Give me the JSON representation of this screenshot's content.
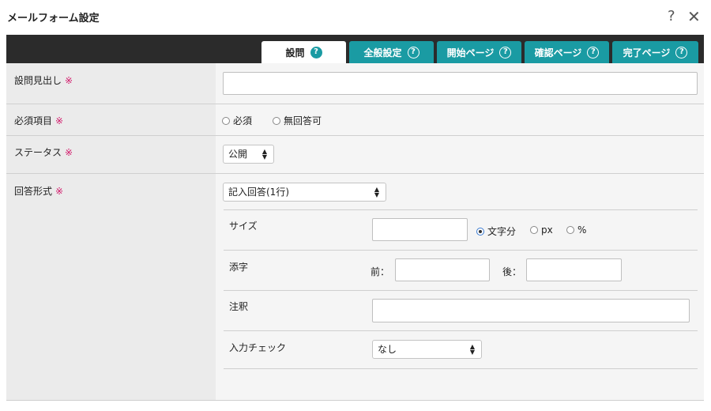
{
  "dialog": {
    "title": "メールフォーム設定",
    "help_icon": "?",
    "close_icon": "✕"
  },
  "tabs": [
    {
      "label": "設問",
      "active": true
    },
    {
      "label": "全般設定",
      "active": false
    },
    {
      "label": "開始ページ",
      "active": false
    },
    {
      "label": "確認ページ",
      "active": false
    },
    {
      "label": "完了ページ",
      "active": false
    }
  ],
  "tab_help": "?",
  "required_mark": "※",
  "fields": {
    "heading": {
      "label": "設問見出し",
      "value": ""
    },
    "required": {
      "label": "必須項目",
      "options": [
        "必須",
        "無回答可"
      ],
      "selected": null
    },
    "status": {
      "label": "ステータス",
      "value": "公開"
    },
    "answer_type": {
      "label": "回答形式",
      "value": "記入回答(1行)"
    }
  },
  "sub": {
    "size": {
      "label": "サイズ",
      "value": "",
      "units": [
        "文字分",
        "px",
        "%"
      ],
      "selected": "文字分"
    },
    "affix": {
      "label": "添字",
      "before_label": "前：",
      "after_label": "後：",
      "before": "",
      "after": ""
    },
    "note": {
      "label": "注釈",
      "value": ""
    },
    "input_check": {
      "label": "入力チェック",
      "value": "なし"
    }
  },
  "colors": {
    "accent": "#1a9ba3",
    "required": "#d2196a",
    "tabbar": "#2b2b2b"
  }
}
